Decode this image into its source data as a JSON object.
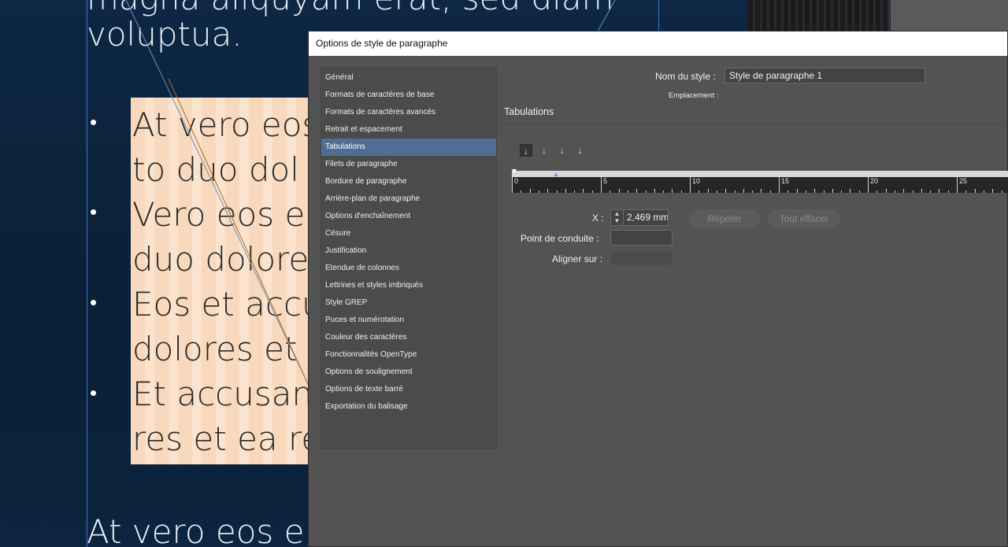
{
  "canvas": {
    "top_cut_text": "magna aliquyam erat, sed diam",
    "top_line_text": "voluptua.",
    "bullet_glyph": "•",
    "peach_lines": [
      "At vero eos",
      "to duo dol",
      "Vero eos e",
      "duo dolore",
      "Eos et accu",
      "dolores et",
      "Et accusan",
      "res et ea re"
    ],
    "bottom_line_text": "At vero eos e"
  },
  "dialog": {
    "title": "Options de style de paragraphe",
    "nav_items": [
      "Général",
      "Formats de caractères de base",
      "Formats de caractères avancés",
      "Retrait et espacement",
      "Tabulations",
      "Filets de paragraphe",
      "Bordure de paragraphe",
      "Arrière-plan de paragraphe",
      "Options d'enchaînement",
      "Césure",
      "Justification",
      "Etendue de colonnes",
      "Lettrines et styles imbriqués",
      "Style GREP",
      "Puces et numérotation",
      "Couleur des caractères",
      "Fonctionnalités OpenType",
      "Options de soulignement",
      "Options de texte barré",
      "Exportation du balisage"
    ],
    "active_nav_index": 4,
    "style_name_label": "Nom du style :",
    "style_name_value": "Style de paragraphe 1",
    "location_label": "Emplacement :",
    "section_title": "Tabulations",
    "tab_icons": [
      "left-align-tab-icon",
      "center-align-tab-icon",
      "right-align-tab-icon",
      "decimal-align-tab-icon"
    ],
    "tab_icon_glyphs": [
      "↓",
      "↓",
      "↓",
      "↓"
    ],
    "ruler_labels": [
      "0",
      "5",
      "10",
      "15",
      "20",
      "25"
    ],
    "tab_stop_value_mm": 2.469,
    "x_label": "X :",
    "x_value": "2,469 mm",
    "leader_label": "Point de conduite :",
    "leader_value": "",
    "align_on_label": "Aligner sur :",
    "align_on_value": "",
    "repeat_button": "Répéter",
    "clear_all_button": "Tout effacer",
    "colors": {
      "active_nav": "#4e6e94",
      "dialog_bg": "#535353",
      "tab_marker": "#5aa8ff"
    }
  }
}
